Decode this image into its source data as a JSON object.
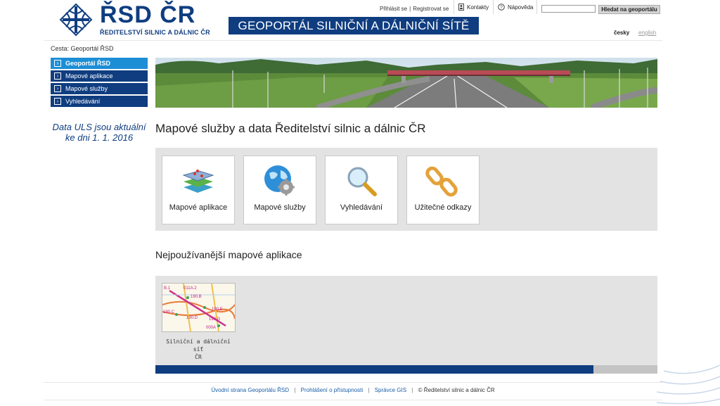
{
  "header": {
    "logo_main": "ŘSD ČR",
    "logo_sub": "ŘEDITELSTVÍ SILNIC A DÁLNIC ČR",
    "title": "GEOPORTÁL SILNIČNÍ A DÁLNIČNÍ SÍTĚ ČR",
    "login": "Přihlásit se",
    "register": "Registrovat se",
    "contacts": "Kontakty",
    "help": "Nápověda",
    "search_value": "",
    "search_button": "Hledat na geoportálu",
    "lang_cz": "česky",
    "lang_en": "english"
  },
  "breadcrumb": "Cesta: Geoportál ŘSD",
  "sidebar": {
    "items": [
      {
        "label": "Geoportál ŘSD"
      },
      {
        "label": "Mapové aplikace"
      },
      {
        "label": "Mapové služby"
      },
      {
        "label": "Vyhledávání"
      }
    ],
    "notice_line1": "Data ULS jsou aktuální",
    "notice_line2": "ke dni 1. 1. 2016"
  },
  "main": {
    "heading": "Mapové služby a data Ředitelství silnic a dálnic ČR",
    "tiles": [
      {
        "label": "Mapové aplikace",
        "icon": "map-layers-icon"
      },
      {
        "label": "Mapové služby",
        "icon": "globe-gear-icon"
      },
      {
        "label": "Vyhledávání",
        "icon": "magnifier-icon"
      },
      {
        "label": "Užitečné odkazy",
        "icon": "chain-link-icon"
      }
    ],
    "apps_heading": "Nejpoužívanější mapové aplikace",
    "apps": [
      {
        "label_line1": "Silniční a dálniční síť",
        "label_line2": "ČR",
        "thumb_labels": [
          "B.1",
          "011A.2",
          "190.B",
          "190.C",
          "190.E",
          "190.D",
          "190.G",
          "000A"
        ]
      }
    ]
  },
  "footer": {
    "links": [
      "Úvodní strana Geoportálu ŘSD",
      "Prohlášení o přístupnosti",
      "Správce GIS"
    ],
    "copyright": "© Ředitelství silnic a dálnic ČR"
  },
  "colors": {
    "brand_blue": "#0f3d80",
    "active_blue": "#1c8ed6",
    "panel_grey": "#e3e3e3"
  }
}
